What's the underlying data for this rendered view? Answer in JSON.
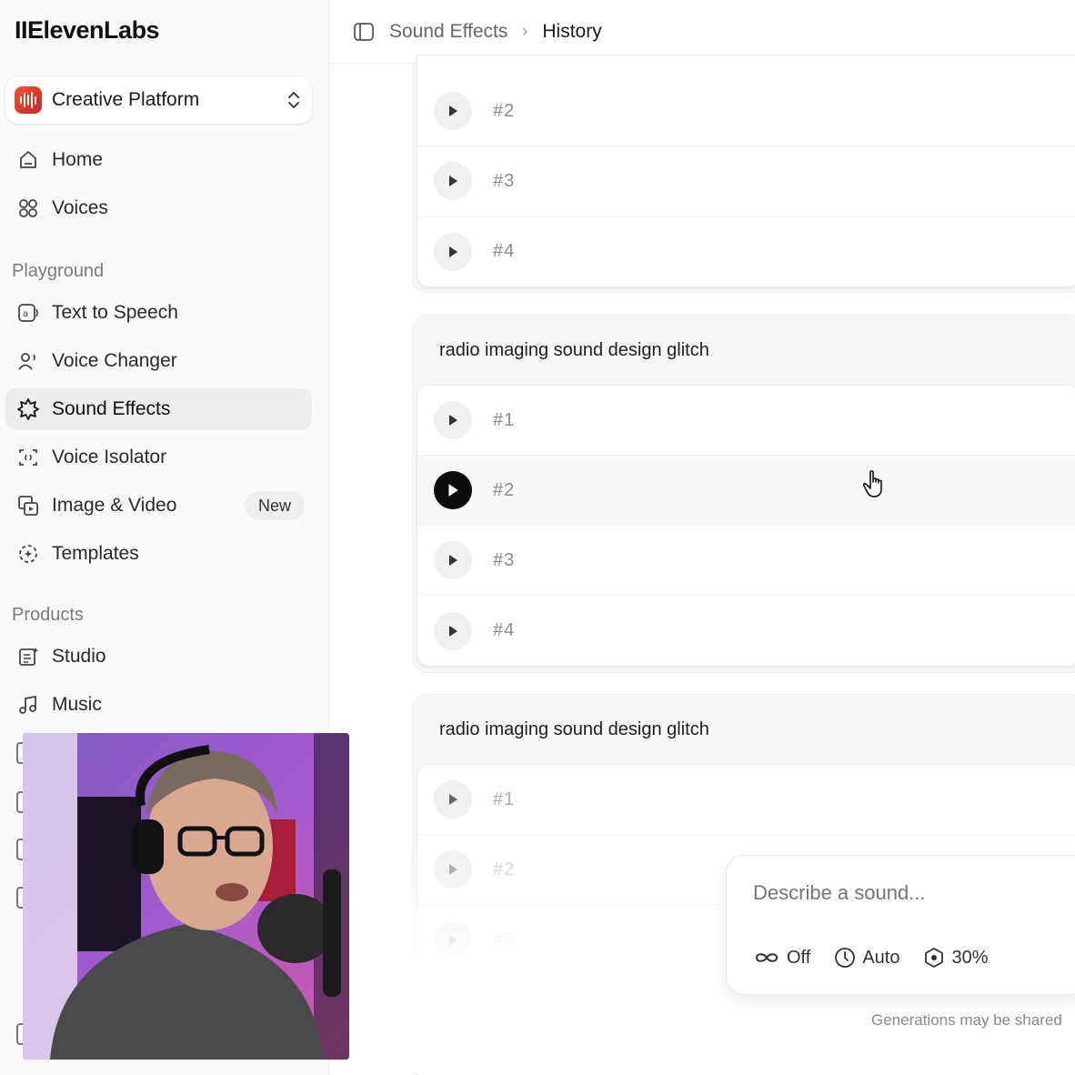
{
  "app": {
    "logo": "IIElevenLabs"
  },
  "workspace": {
    "name": "Creative Platform"
  },
  "sidebar": {
    "main": [
      {
        "label": "Home",
        "icon": "home-icon"
      },
      {
        "label": "Voices",
        "icon": "voices-icon"
      }
    ],
    "playground_title": "Playground",
    "playground": [
      {
        "label": "Text to Speech",
        "icon": "text-to-speech-icon"
      },
      {
        "label": "Voice Changer",
        "icon": "voice-changer-icon"
      },
      {
        "label": "Sound Effects",
        "icon": "sound-effects-icon",
        "active": true
      },
      {
        "label": "Voice Isolator",
        "icon": "voice-isolator-icon"
      },
      {
        "label": "Image & Video",
        "icon": "image-video-icon",
        "badge": "New"
      },
      {
        "label": "Templates",
        "icon": "templates-icon"
      }
    ],
    "products_title": "Products",
    "products": [
      {
        "label": "Studio",
        "icon": "studio-icon"
      },
      {
        "label": "Music",
        "icon": "music-icon"
      }
    ]
  },
  "breadcrumb": {
    "parent": "Sound Effects",
    "current": "History"
  },
  "groups": [
    {
      "title": "",
      "rows": [
        "#2",
        "#3",
        "#4"
      ]
    },
    {
      "title": "radio imaging sound design glitch",
      "rows": [
        "#1",
        "#2",
        "#3",
        "#4"
      ]
    },
    {
      "title": "radio imaging sound design glitch",
      "rows": [
        "#1",
        "#2",
        "#3"
      ]
    }
  ],
  "prompt": {
    "placeholder": "Describe a sound...",
    "loop": "Off",
    "duration": "Auto",
    "influence": "30%"
  },
  "notice": "Generations may be shared",
  "colors": {
    "accent": "#0c0c0c",
    "brand": "#e5442c"
  }
}
